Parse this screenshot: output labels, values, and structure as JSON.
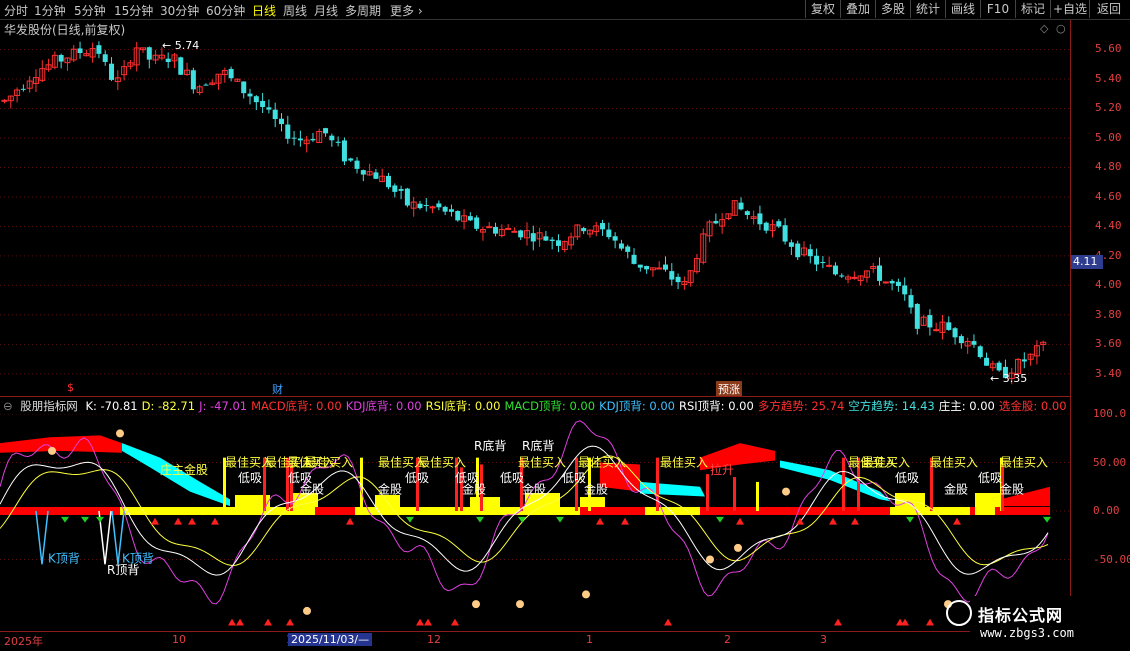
{
  "toolbar": {
    "timeframes": [
      "分时",
      "1分钟",
      "5分钟",
      "15分钟",
      "30分钟",
      "60分钟",
      "日线",
      "周线",
      "月线",
      "多周期",
      "更多"
    ],
    "active_timeframe": "日线",
    "right_buttons": [
      "复权",
      "叠加",
      "多股",
      "统计",
      "画线",
      "F10",
      "标记",
      "+自选",
      "返回"
    ]
  },
  "main_chart": {
    "title": "华发股份(日线,前复权)",
    "high_label": "5.74",
    "low_label": "3.35",
    "current_price": "4.11",
    "price_labels": [
      "5.60",
      "5.40",
      "5.20",
      "5.00",
      "4.80",
      "4.60",
      "4.40",
      "4.20",
      "4.00",
      "3.80",
      "3.60",
      "3.40"
    ],
    "price_values": [
      5.6,
      5.4,
      5.2,
      5.0,
      4.8,
      4.6,
      4.4,
      4.2,
      4.0,
      3.8,
      3.6,
      3.4
    ],
    "event_markers": [
      {
        "text": "$",
        "color": "#ff3030"
      },
      {
        "text": "财",
        "color": "#40a0ff"
      },
      {
        "text": "预涨",
        "color": "#ffffff"
      }
    ]
  },
  "indicator": {
    "name": "股朋指标网",
    "values": [
      {
        "text": "K: -70.81",
        "color": "#ffffff"
      },
      {
        "text": "D: -82.71",
        "color": "#ffff40"
      },
      {
        "text": "J: -47.01",
        "color": "#e040e0"
      },
      {
        "text": "MACD底背: 0.00",
        "color": "#ff3030"
      },
      {
        "text": "KDJ底背: 0.00",
        "color": "#e040e0"
      },
      {
        "text": "RSI底背: 0.00",
        "color": "#ffff40"
      },
      {
        "text": "MACD顶背: 0.00",
        "color": "#30e030"
      },
      {
        "text": "KDJ顶背: 0.00",
        "color": "#40c0ff"
      },
      {
        "text": "RSI顶背: 0.00",
        "color": "#ffffff"
      },
      {
        "text": "多方趋势: 25.74",
        "color": "#ff3030"
      },
      {
        "text": "空方趋势: 14.43",
        "color": "#40e0e0"
      },
      {
        "text": "庄主: 0.00",
        "color": "#ffffff"
      },
      {
        "text": "选金股: 0.00",
        "color": "#ff3030"
      },
      {
        "text": "最",
        "color": "#ff3030"
      }
    ],
    "axis_labels": [
      "100.0",
      "50.00",
      "0.00",
      "-50.00"
    ],
    "axis_values": [
      100,
      50,
      0,
      -50
    ],
    "signal_labels": {
      "best_buy": "最佳买入",
      "low_buy": "低吸",
      "gold": "金股",
      "r_bottom": "R底背",
      "r_top": "R顶背",
      "k_top": "K顶背",
      "dealer_gold": "庄主金股",
      "lift": "拉升"
    }
  },
  "date_axis": {
    "labels": [
      "2025年",
      "10",
      "11",
      "12",
      "1",
      "2",
      "3"
    ],
    "cursor_date": "2025/11/03/—"
  },
  "watermark": {
    "line1": "指标公式网",
    "line2": "www.zbgs3.com"
  },
  "colors": {
    "up": "#ff3030",
    "down": "#40e0e0",
    "k": "#ffffff",
    "d": "#ffff40",
    "j": "#e040e0",
    "bull": "#ff0000",
    "bear": "#00ffff",
    "yellow": "#ffff00"
  }
}
